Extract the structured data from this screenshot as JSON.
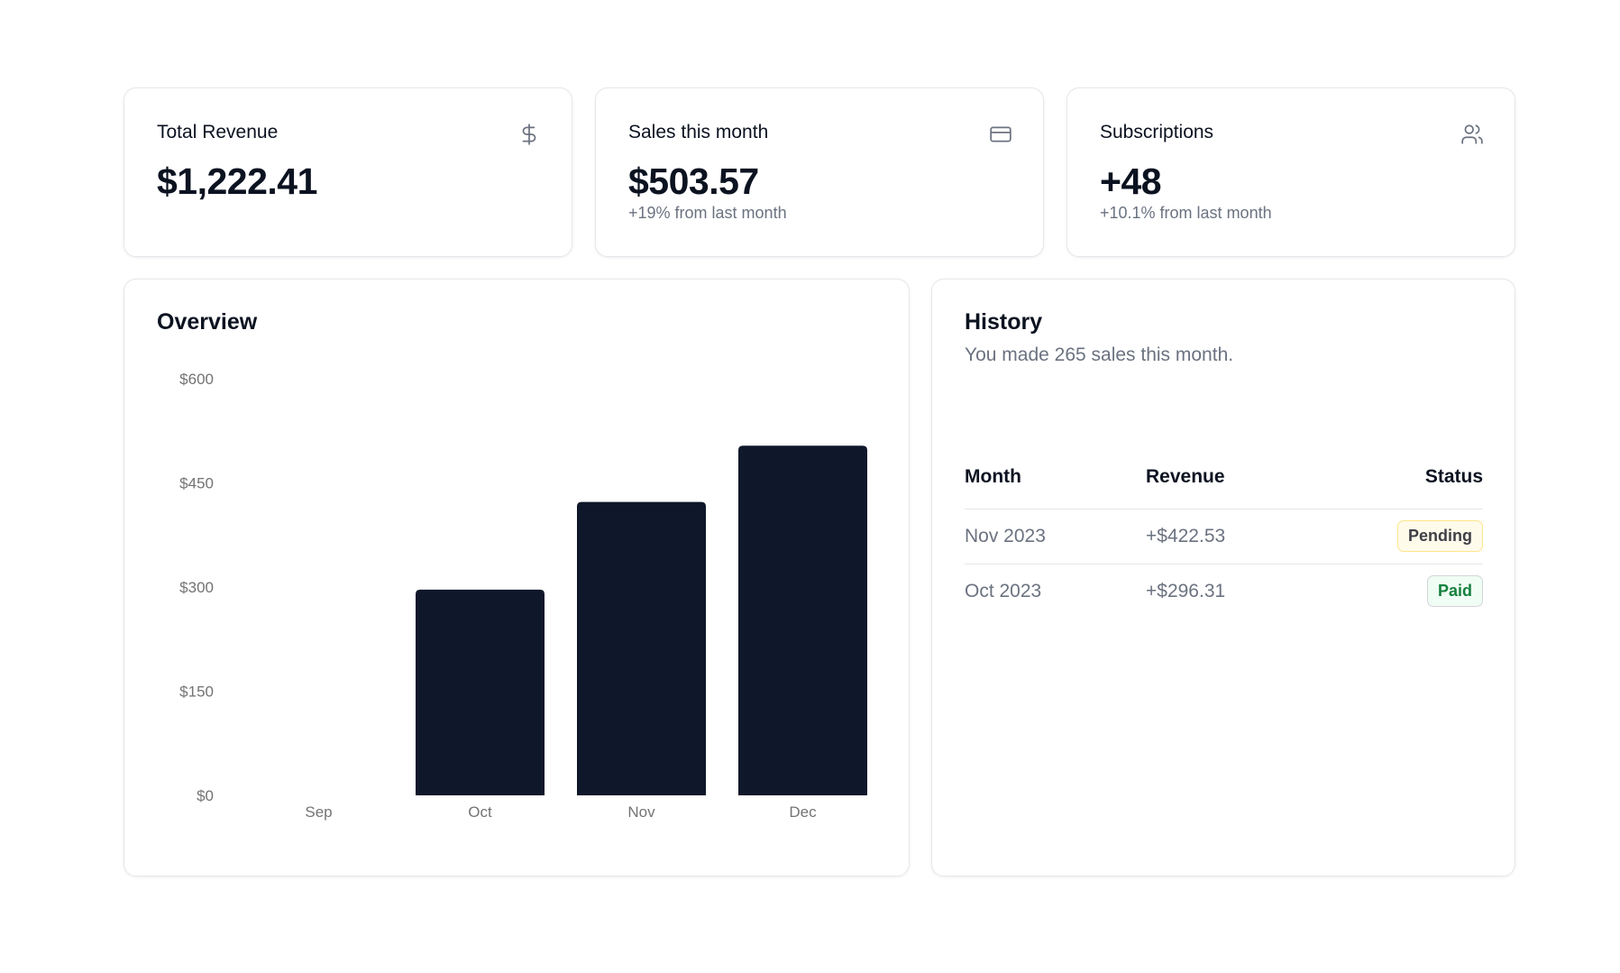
{
  "colors": {
    "bar": "#0f172a",
    "pending_bg": "#fffbeb",
    "paid_text": "#15803d"
  },
  "stats": [
    {
      "title": "Total Revenue",
      "value": "$1,222.41",
      "sub": "",
      "icon": "dollar-icon"
    },
    {
      "title": "Sales this month",
      "value": "$503.57",
      "sub": "+19% from last month",
      "icon": "credit-card-icon"
    },
    {
      "title": "Subscriptions",
      "value": "+48",
      "sub": "+10.1% from last month",
      "icon": "users-icon"
    }
  ],
  "overview": {
    "title": "Overview"
  },
  "chart_data": {
    "type": "bar",
    "title": "Overview",
    "categories": [
      "Sep",
      "Oct",
      "Nov",
      "Dec"
    ],
    "values": [
      0,
      296.31,
      422.53,
      503.57
    ],
    "ylim": [
      0,
      600
    ],
    "yticks": [
      0,
      150,
      300,
      450,
      600
    ],
    "ytick_labels": [
      "$0",
      "$150",
      "$300",
      "$450",
      "$600"
    ],
    "grid": false,
    "legend": "none"
  },
  "history": {
    "title": "History",
    "subtitle": "You made 265 sales this month.",
    "columns": {
      "month": "Month",
      "revenue": "Revenue",
      "status": "Status"
    },
    "rows": [
      {
        "month": "Nov 2023",
        "revenue": "+$422.53",
        "status": "Pending"
      },
      {
        "month": "Oct 2023",
        "revenue": "+$296.31",
        "status": "Paid"
      }
    ]
  }
}
